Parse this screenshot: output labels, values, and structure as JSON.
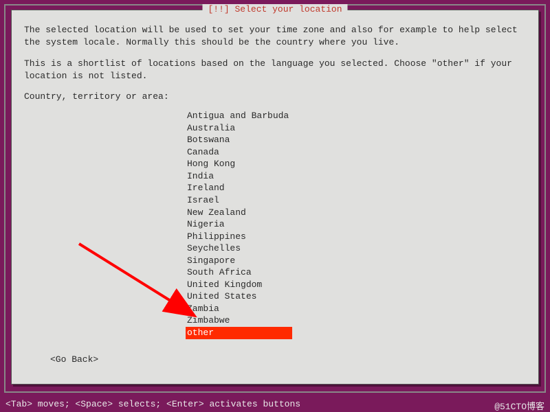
{
  "colors": {
    "background": "#7a1a5b",
    "dialog_bg": "#e0e0de",
    "title_red": "#c0392b",
    "highlight": "#ff2a00",
    "arrow": "#ff0000"
  },
  "dialog": {
    "title": "[!!] Select your location",
    "paragraph1": "The selected location will be used to set your time zone and also for example to help select the system locale. Normally this should be the country where you live.",
    "paragraph2": "This is a shortlist of locations based on the language you selected. Choose \"other\" if your location is not listed.",
    "prompt": "Country, territory or area:",
    "locations": [
      "Antigua and Barbuda",
      "Australia",
      "Botswana",
      "Canada",
      "Hong Kong",
      "India",
      "Ireland",
      "Israel",
      "New Zealand",
      "Nigeria",
      "Philippines",
      "Seychelles",
      "Singapore",
      "South Africa",
      "United Kingdom",
      "United States",
      "Zambia",
      "Zimbabwe",
      "other"
    ],
    "selected_index": 18,
    "go_back": "<Go Back>"
  },
  "footer": {
    "help": "<Tab> moves; <Space> selects; <Enter> activates buttons",
    "watermark": "@51CTO博客"
  }
}
